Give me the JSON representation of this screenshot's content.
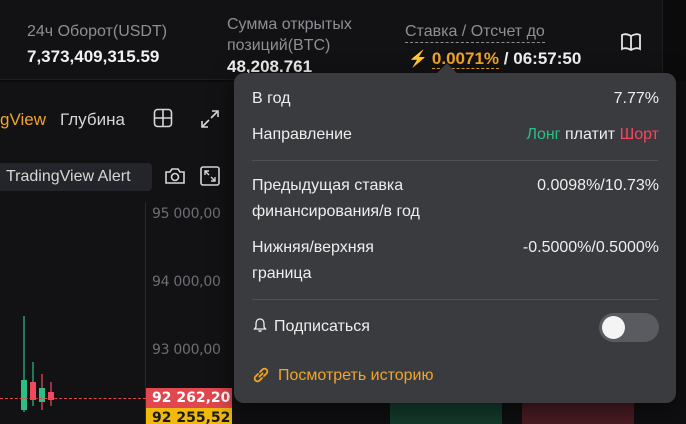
{
  "topbar": {
    "turnover_label": "24ч Оборот(USDT)",
    "turnover_value": "7,373,409,315.59",
    "oi_label_line1": "Сумма открытых",
    "oi_label_line2": "позиций(BTC)",
    "oi_value": "48,208.761",
    "funding_label": "Ставка / Отсчет до",
    "funding_rate": "0.0071%",
    "funding_separator": "/",
    "funding_countdown": "06:57:50",
    "icons": {
      "bolt": "lightning-bolt-icon",
      "book": "book-icon"
    }
  },
  "chart": {
    "tabs": [
      "gView",
      "Глубина"
    ],
    "tv_alert_label": "TradingView Alert",
    "price_levels": [
      "95 000,00",
      "94 000,00",
      "93 000,00"
    ],
    "price_tag_red": "92 262,20",
    "price_tag_yellow": "92 255,52",
    "icons": [
      "grid-icon",
      "expand-icon",
      "camera-icon",
      "fullscreen-icon"
    ]
  },
  "popover": {
    "annual_label": "В год",
    "annual_value": "7.77%",
    "direction_label": "Направление",
    "direction_long": "Лонг",
    "direction_pays": "платит",
    "direction_short": "Шорт",
    "prev_rate_label_line1": "Предыдущая ставка",
    "prev_rate_label_line2": "финансирования/в год",
    "prev_rate_value": "0.0098%/10.73%",
    "bounds_label_line1": "Нижняя/верхняя",
    "bounds_label_line2": "граница",
    "bounds_value": "-0.5000%/0.5000%",
    "subscribe_label": "Подписаться",
    "subscribe_enabled": false,
    "history_link": "Посмотреть историю"
  },
  "colors": {
    "accent": "#f0a52a",
    "long": "#2ebd85",
    "short": "#f6465d",
    "popover_bg": "#3a3b3f"
  }
}
